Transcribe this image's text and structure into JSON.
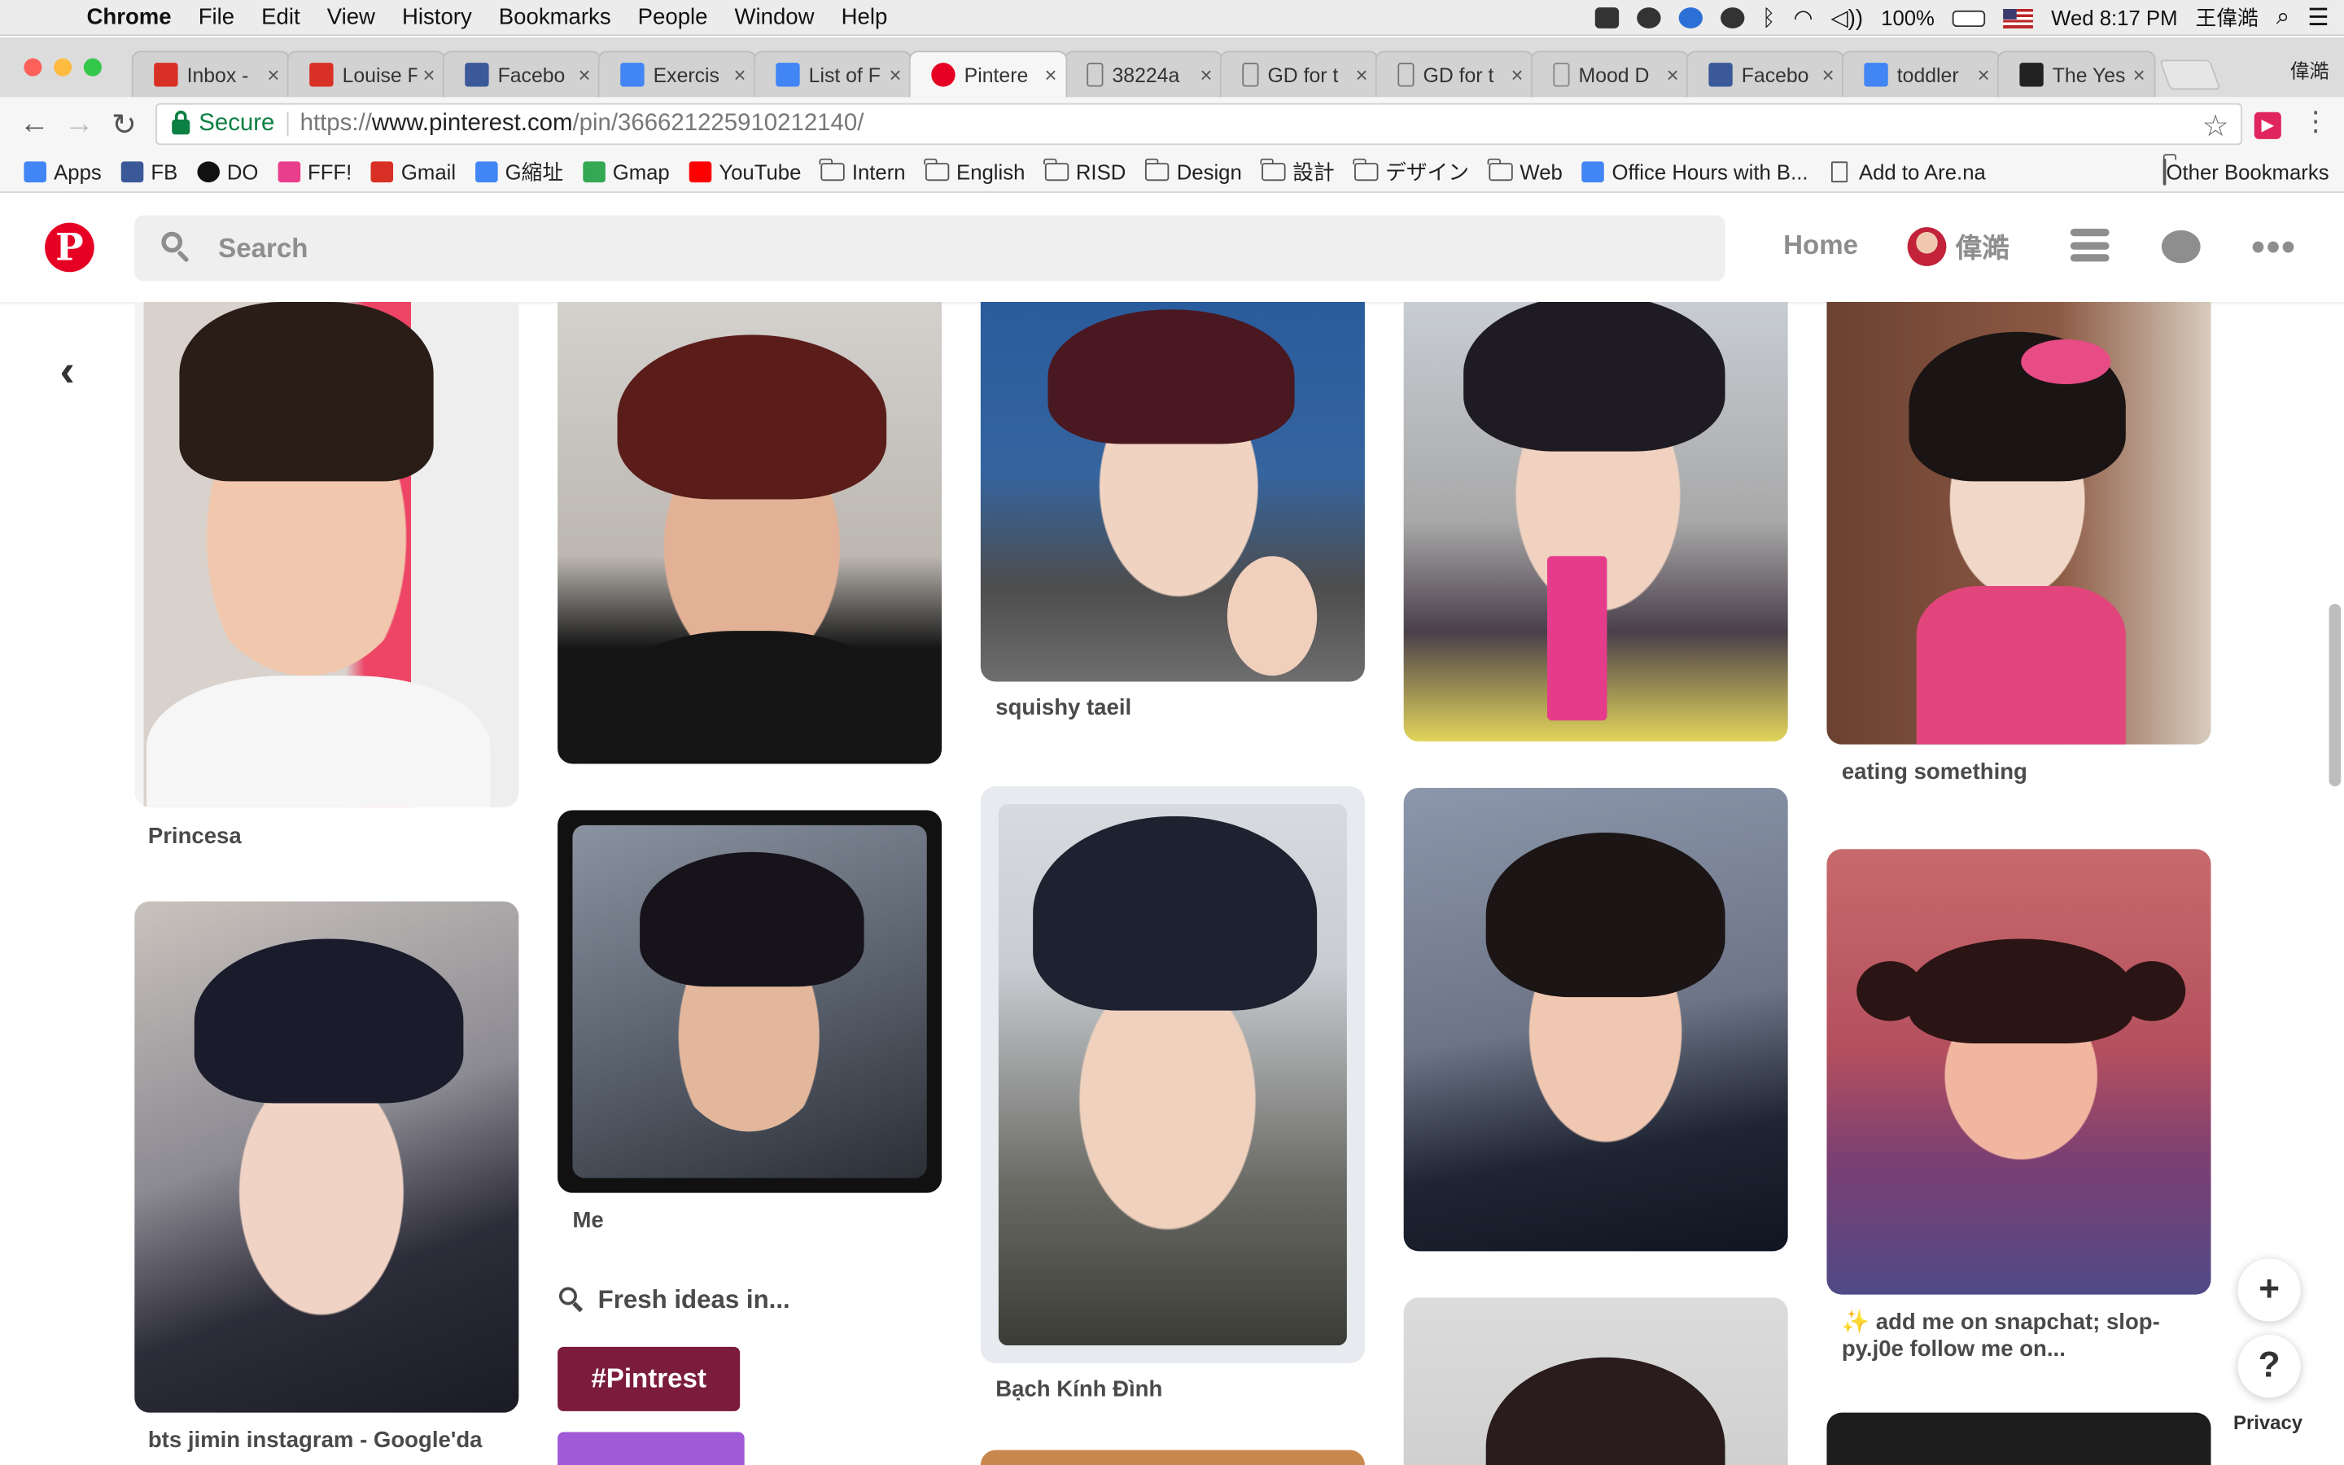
{
  "menubar": {
    "app": "Chrome",
    "items": [
      "File",
      "Edit",
      "View",
      "History",
      "Bookmarks",
      "People",
      "Window",
      "Help"
    ],
    "battery": "100%",
    "clock": "Wed 8:17 PM",
    "user": "王偉澔"
  },
  "tabs": [
    {
      "title": "Inbox -",
      "icon": "gmail-icon",
      "color": "#d93025"
    },
    {
      "title": "Louise F",
      "icon": "gmail-icon",
      "color": "#d93025"
    },
    {
      "title": "Facebo",
      "icon": "facebook-icon",
      "color": "#3b5998"
    },
    {
      "title": "Exercis",
      "icon": "docs-icon",
      "color": "#4285f4"
    },
    {
      "title": "List of F",
      "icon": "docs-icon",
      "color": "#4285f4"
    },
    {
      "title": "Pintere",
      "icon": "pinterest-icon",
      "color": "#e60023",
      "active": true
    },
    {
      "title": "38224a",
      "icon": "page-icon",
      "color": "#777777"
    },
    {
      "title": "GD for t",
      "icon": "page-icon",
      "color": "#777777"
    },
    {
      "title": "GD for t",
      "icon": "page-icon",
      "color": "#777777"
    },
    {
      "title": "Mood D",
      "icon": "mood-icon",
      "color": "#888888"
    },
    {
      "title": "Facebo",
      "icon": "facebook-icon",
      "color": "#3b5998"
    },
    {
      "title": "toddler",
      "icon": "google-icon",
      "color": "#4285f4"
    },
    {
      "title": "The Yes",
      "icon": "wikipedia-icon",
      "color": "#222222"
    }
  ],
  "profile_name": "偉澔",
  "address": {
    "secure_label": "Secure",
    "scheme": "https://",
    "host": "www.pinterest.com",
    "path": "/pin/366621225910212140/"
  },
  "bookmarks": [
    {
      "label": "Apps",
      "icon": "apps-icon"
    },
    {
      "label": "FB",
      "icon": "facebook-icon"
    },
    {
      "label": "DO",
      "icon": "do-icon"
    },
    {
      "label": "FFF!",
      "icon": "heart-icon"
    },
    {
      "label": "Gmail",
      "icon": "gmail-icon"
    },
    {
      "label": "G縮址",
      "icon": "google-icon"
    },
    {
      "label": "Gmap",
      "icon": "maps-icon"
    },
    {
      "label": "YouTube",
      "icon": "youtube-icon"
    },
    {
      "label": "Intern",
      "icon": "folder-icon"
    },
    {
      "label": "English",
      "icon": "folder-icon"
    },
    {
      "label": "RISD",
      "icon": "folder-icon"
    },
    {
      "label": "Design",
      "icon": "folder-icon"
    },
    {
      "label": "設計",
      "icon": "folder-icon"
    },
    {
      "label": "デザイン",
      "icon": "folder-icon"
    },
    {
      "label": "Web",
      "icon": "folder-icon"
    },
    {
      "label": "Office Hours with B...",
      "icon": "docs-icon"
    },
    {
      "label": "Add to Are.na",
      "icon": "page-icon"
    }
  ],
  "other_bookmarks": "Other Bookmarks",
  "pinterest": {
    "search_placeholder": "Search",
    "home": "Home",
    "username": "偉澔",
    "brand_color": "#e60023"
  },
  "pins": {
    "princesa": "Princesa",
    "squishy": "squishy taeil",
    "eating": "eating something",
    "me": "Me",
    "bach": "Bạch Kính Đình",
    "snapchat": "✨ add me on snapchat; slop-py.j0e follow me on...",
    "jimin": "bts jimin instagram - Google'da"
  },
  "fresh_ideas": "Fresh ideas in...",
  "hashtag": "#Pintrest",
  "fab": {
    "plus": "+",
    "help": "?"
  },
  "privacy": "Privacy"
}
